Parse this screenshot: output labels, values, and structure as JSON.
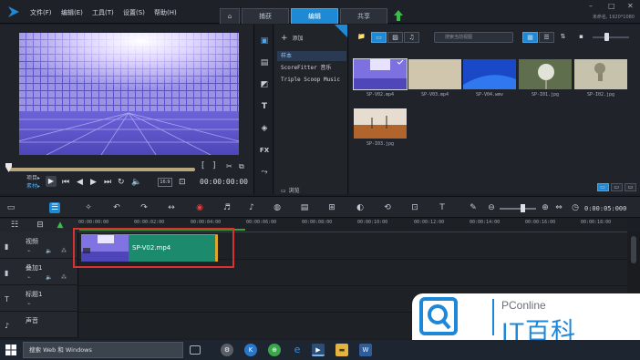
{
  "menu": [
    {
      "label": "文件(F)"
    },
    {
      "label": "编辑(E)"
    },
    {
      "label": "工具(T)"
    },
    {
      "label": "设置(S)"
    },
    {
      "label": "帮助(H)"
    }
  ],
  "tabs": [
    {
      "label": "⌂",
      "name": "tab-home"
    },
    {
      "label": "捕获",
      "name": "tab-capture"
    },
    {
      "label": "编辑",
      "name": "tab-edit",
      "active": true
    },
    {
      "label": "共享",
      "name": "tab-share"
    }
  ],
  "resolution_info": "未命名, 1920*1080",
  "player": {
    "mode_project": "项目▸",
    "mode_clip": "素材▸",
    "timecode": "00:00:00:00",
    "resolution_select": "16:9",
    "progress": 0.0
  },
  "library": {
    "add_label": "添加",
    "browse_label": "浏览",
    "folders": [
      "样本",
      "ScoreFitter 音乐",
      "Triple Scoop Music"
    ],
    "search_placeholder": "搜索当前视图",
    "items": [
      {
        "label": "SP-V02.mp4",
        "kind": "purple-floor",
        "selected": true
      },
      {
        "label": "SP-V03.mp4",
        "kind": "beige"
      },
      {
        "label": "SP-V04.wmv",
        "kind": "blue"
      },
      {
        "label": "SP-I01.jpg",
        "kind": "dandelion"
      },
      {
        "label": "SP-I02.jpg",
        "kind": "tree-mist"
      },
      {
        "label": "SP-I03.jpg",
        "kind": "trees-sand"
      }
    ]
  },
  "timeline": {
    "timecode": "0:00:05:000",
    "ruler_ticks": [
      "00:00:00:00",
      "00:00:02:00",
      "00:00:04:00",
      "00:00:06:00",
      "00:00:08:00",
      "00:00:10:00",
      "00:00:12:00",
      "00:00:14:00",
      "00:00:16:00",
      "00:00:18:00"
    ],
    "tracks": [
      {
        "name": "视频",
        "icon": "▮"
      },
      {
        "name": "叠加1",
        "icon": "▮"
      },
      {
        "name": "标题1",
        "icon": "T"
      },
      {
        "name": "声音",
        "icon": "♪"
      }
    ],
    "clip_label": "SP-V02.mp4"
  },
  "watermark": {
    "brand": "PConline",
    "title": "IT百科"
  },
  "taskbar": {
    "search_text": "搜索 Web 和 Windows"
  },
  "colors": {
    "accent": "#1e8ad6",
    "clip": "#1c8a6d",
    "highlight": "#d7322f",
    "background": "#1b1e25"
  }
}
